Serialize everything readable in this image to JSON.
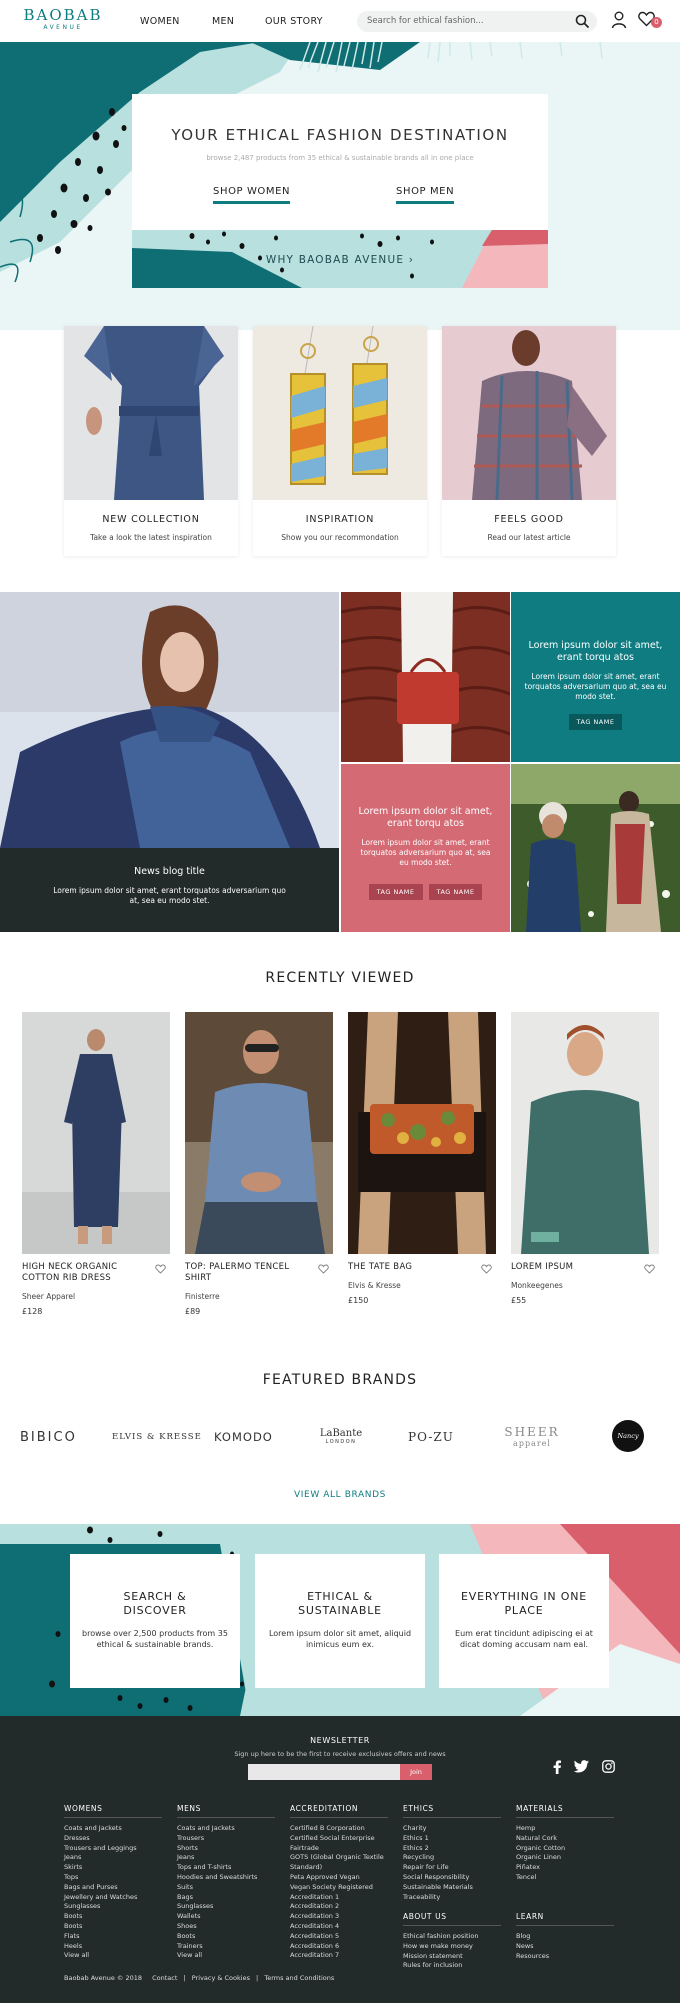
{
  "header": {
    "logo_main": "BAOBAB",
    "logo_sub": "AVENUE",
    "nav": [
      "WOMEN",
      "MEN",
      "OUR STORY"
    ],
    "search_placeholder": "Search for ethical fashion...",
    "cart_count": "0"
  },
  "hero": {
    "title": "YOUR ETHICAL FASHION DESTINATION",
    "subtitle": "browse 2,487 products from 35 ethical & sustainable brands all in one place",
    "shop_women": "SHOP WOMEN",
    "shop_men": "SHOP MEN",
    "why": "WHY BAOBAB AVENUE"
  },
  "categories": [
    {
      "title": "NEW COLLECTION",
      "subtitle": "Take a look the latest inspiration"
    },
    {
      "title": "INSPIRATION",
      "subtitle": "Show you our recommondation"
    },
    {
      "title": "FEELS GOOD",
      "subtitle": "Read our latest article"
    }
  ],
  "blog": {
    "main": {
      "title": "News blog title",
      "text": "Lorem ipsum dolor sit amet, erant torquatos adversarium quo at, sea eu modo stet."
    },
    "teal": {
      "title": "Lorem ipsum dolor sit amet, erant torqu atos",
      "text": "Lorem ipsum dolor sit amet, erant torquatos adversarium quo at, sea eu modo stet.",
      "tag": "TAG NAME"
    },
    "pink": {
      "title": "Lorem ipsum dolor sit amet, erant torqu atos",
      "text": "Lorem ipsum dolor sit amet, erant torquatos adversarium quo at, sea eu modo stet.",
      "tags": [
        "TAG NAME",
        "TAG NAME"
      ]
    }
  },
  "recently_viewed": {
    "title": "RECENTLY VIEWED",
    "products": [
      {
        "name": "HIGH NECK ORGANIC COTTON RIB DRESS",
        "brand": "Sheer Apparel",
        "price": "£128"
      },
      {
        "name": "TOP: PALERMO TENCEL SHIRT",
        "brand": "Finisterre",
        "price": "£89"
      },
      {
        "name": "THE TATE BAG",
        "brand": "Elvis & Kresse",
        "price": "£150"
      },
      {
        "name": "LOREM IPSUM",
        "brand": "Monkeegenes",
        "price": "£55"
      }
    ]
  },
  "featured_brands": {
    "title": "FEATURED BRANDS",
    "brands": [
      "BIBICO",
      "ELVIS & KRESSE",
      "KOMODO",
      "LaBante",
      "PO-ZU",
      "SHEER",
      "Nancy Dee"
    ],
    "brand_subs": [
      "",
      "",
      "",
      "LONDON",
      "",
      "apparel",
      ""
    ],
    "view_all": "VIEW ALL BRANDS"
  },
  "promo": [
    {
      "title": "SEARCH & DISCOVER",
      "text": "browse over 2,500 products from 35 ethical & sustainable brands."
    },
    {
      "title": "ETHICAL & SUSTAINABLE",
      "text": "Lorem ipsum dolor sit amet, aliquid inimicus eum ex."
    },
    {
      "title": "EVERYTHING IN ONE PLACE",
      "text": "Eum erat tincidunt adipiscing ei at dicat doming accusam nam eal."
    }
  ],
  "footer": {
    "newsletter_title": "NEWSLETTER",
    "newsletter_sub": "Sign up here to be the first to receive exclusives offers and news",
    "join": "Join",
    "columns": {
      "womens": {
        "title": "WOMENS",
        "items": [
          "Coats and Jackets",
          "Dresses",
          "Trousers and Leggings",
          "Jeans",
          "Skirts",
          "Tops",
          "Bags and Purses",
          "Jewellery and Watches",
          "Sunglasses",
          "Boots",
          "Boots",
          "Flats",
          "Heels",
          "View all"
        ]
      },
      "mens": {
        "title": "MENS",
        "items": [
          "Coats and Jackets",
          "Trousers",
          "Shorts",
          "Jeans",
          "Tops and T-shirts",
          "Hoodies and Sweatshirts",
          "Suits",
          "Bags",
          "Sunglasses",
          "Wallets",
          "Shoes",
          "Boots",
          "Trainers",
          "View all"
        ]
      },
      "accreditation": {
        "title": "ACCREDITATION",
        "items": [
          "Certified B Corporation",
          "Certified Social Enterprise",
          "Fairtrade",
          "GOTS (Global Organic Textile Standard)",
          "Peta Approved Vegan",
          "Vegan Society Registered",
          "Accreditation 1",
          "Accreditation 2",
          "Accreditation 3",
          "Accreditation 4",
          "Accreditation 5",
          "Accreditation 6",
          "Accreditation 7"
        ]
      },
      "ethics": {
        "title": "ETHICS",
        "items": [
          "Charity",
          "Ethics 1",
          "Ethics 2",
          "Recycling",
          "Repair for Life",
          "Social Responsibility",
          "Sustainable Materials",
          "Traceability"
        ]
      },
      "materials": {
        "title": "MATERIALS",
        "items": [
          "Hemp",
          "Natural Cork",
          "Organic Cotton",
          "Organic Linen",
          "Piñatex",
          "Tencel"
        ]
      },
      "about": {
        "title": "ABOUT US",
        "items": [
          "Ethical fashion position",
          "How we make money",
          "Mission statement",
          "Rules for inclusion"
        ]
      },
      "learn": {
        "title": "LEARN",
        "items": [
          "Blog",
          "News",
          "Resources"
        ]
      }
    },
    "legal": [
      "Baobab Avenue © 2018",
      "Contact",
      "Privacy & Cookies",
      "Terms and Conditions"
    ]
  }
}
